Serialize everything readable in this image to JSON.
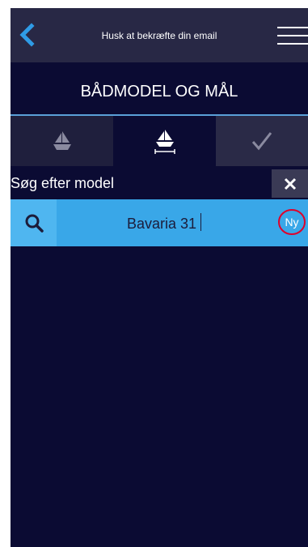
{
  "header": {
    "title": "Husk at bekræfte din email",
    "back_icon": "back-arrow-icon",
    "menu_icon": "hamburger-menu-icon"
  },
  "page": {
    "section_title": "BÅDMODEL OG MÅL"
  },
  "steps": [
    {
      "icon": "sailboat-icon",
      "state": "completed"
    },
    {
      "icon": "sailboat-measure-icon",
      "state": "active"
    },
    {
      "icon": "checkmark-icon",
      "state": "pending"
    }
  ],
  "search": {
    "label": "Søg efter model",
    "value": "Bavaria 31",
    "new_label": "Ny",
    "clear_icon": "close-icon",
    "search_icon": "search-icon"
  },
  "colors": {
    "background": "#0b0b33",
    "topbar": "#282845",
    "accent": "#39a7e8",
    "accent_light": "#4fb6f0",
    "annotation": "#e0002a"
  }
}
